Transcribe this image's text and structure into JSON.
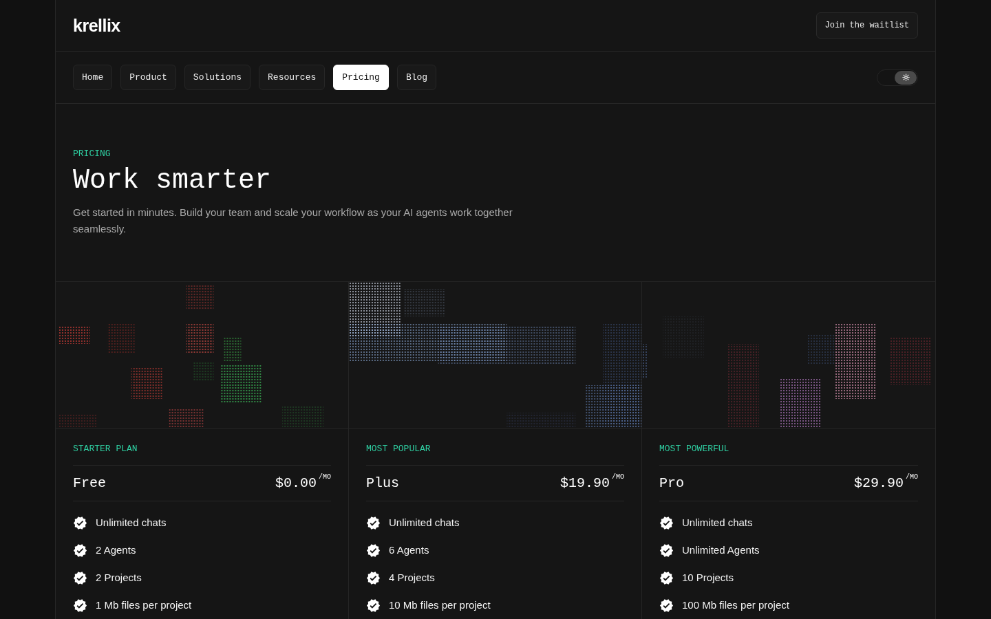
{
  "header": {
    "logo": "krellix",
    "cta": "Join the waitlist"
  },
  "nav": {
    "tabs": [
      {
        "label": "Home",
        "selected": false
      },
      {
        "label": "Product",
        "selected": false
      },
      {
        "label": "Solutions",
        "selected": false
      },
      {
        "label": "Resources",
        "selected": false
      },
      {
        "label": "Pricing",
        "selected": true
      },
      {
        "label": "Blog",
        "selected": false
      }
    ],
    "theme_toggle": {
      "on": true
    }
  },
  "hero": {
    "eyebrow": "PRICING",
    "title": "Work smarter",
    "description": "Get started in minutes. Build your team and scale your workflow as your AI agents work together seamlessly."
  },
  "plans": [
    {
      "tag": "STARTER PLAN",
      "name": "Free",
      "price": "$0.00",
      "period": "/MO",
      "features": [
        "Unlimited chats",
        "2 Agents",
        "2 Projects",
        "1 Mb files per project"
      ]
    },
    {
      "tag": "MOST POPULAR",
      "name": "Plus",
      "price": "$19.90",
      "period": "/MO",
      "features": [
        "Unlimited chats",
        "6 Agents",
        "4 Projects",
        "10 Mb files per project"
      ]
    },
    {
      "tag": "MOST POWERFUL",
      "name": "Pro",
      "price": "$29.90",
      "period": "/MO",
      "features": [
        "Unlimited chats",
        "Unlimited Agents",
        "10 Projects",
        "100 Mb files per project"
      ]
    }
  ]
}
